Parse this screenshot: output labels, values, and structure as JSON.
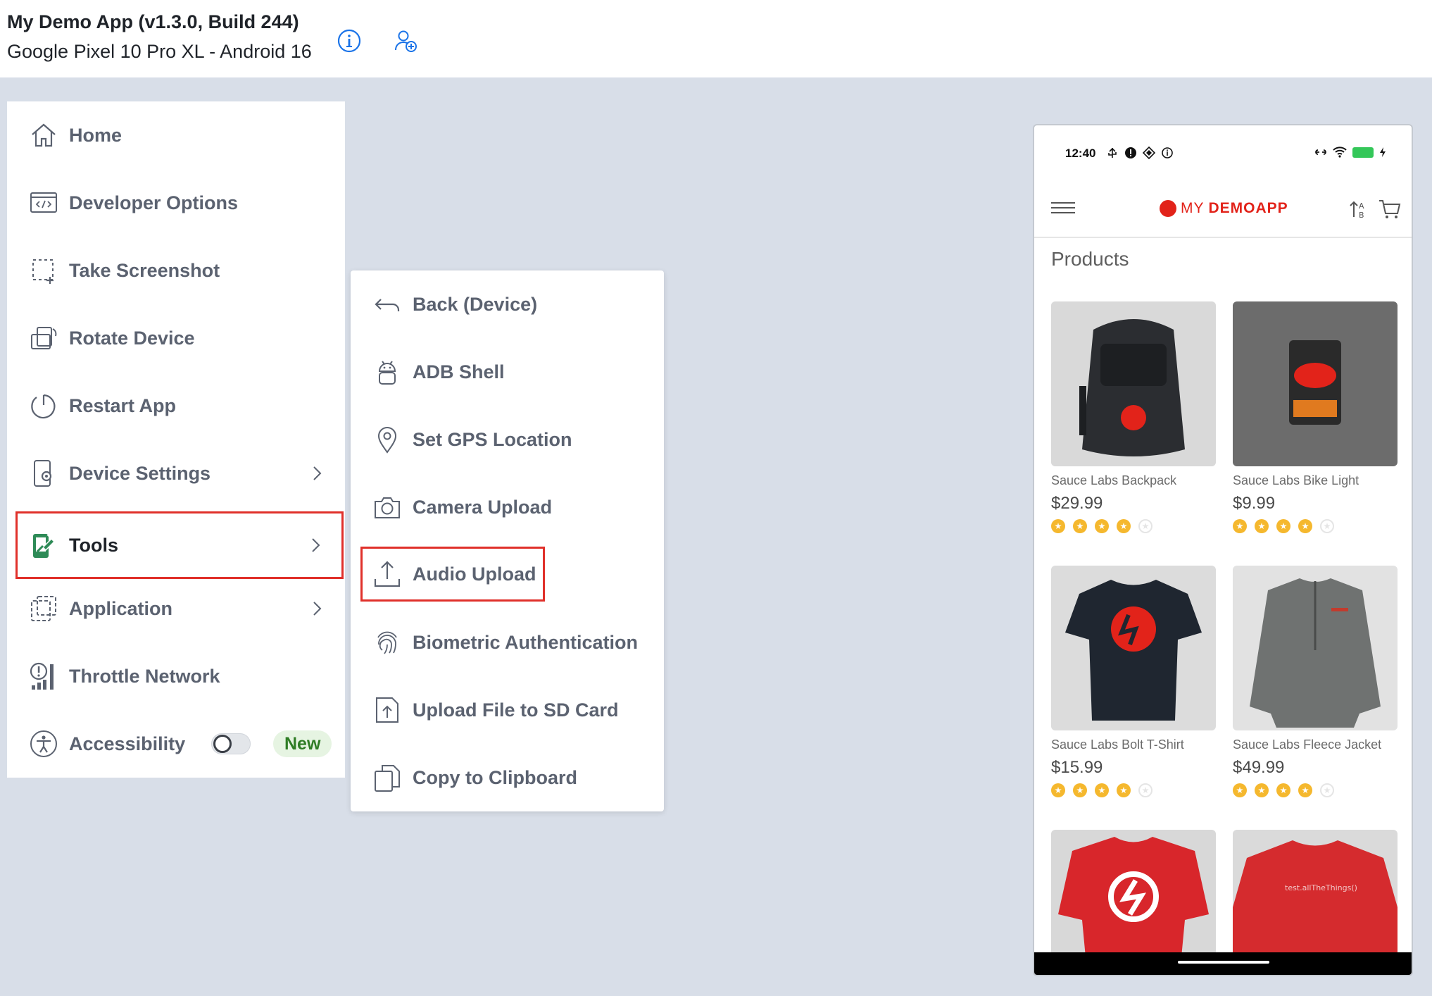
{
  "header": {
    "app_title": "My Demo App (v1.3.0, Build 244)",
    "device": "Google Pixel 10 Pro XL - Android 16",
    "icons": [
      "info-icon",
      "add-user-icon"
    ],
    "accent_color": "#1a73e8"
  },
  "left_menu": {
    "items": [
      {
        "label": "Home",
        "icon": "home-icon"
      },
      {
        "label": "Developer Options",
        "icon": "code-window-icon"
      },
      {
        "label": "Take Screenshot",
        "icon": "screenshot-icon"
      },
      {
        "label": "Rotate Device",
        "icon": "rotate-device-icon"
      },
      {
        "label": "Restart App",
        "icon": "restart-icon"
      },
      {
        "label": "Device Settings",
        "icon": "device-settings-icon",
        "has_submenu": true
      },
      {
        "label": "Tools",
        "icon": "tools-icon",
        "has_submenu": true,
        "selected": true
      },
      {
        "label": "Application",
        "icon": "application-icon",
        "has_submenu": true
      },
      {
        "label": "Throttle Network",
        "icon": "throttle-network-icon"
      },
      {
        "label": "Accessibility",
        "icon": "accessibility-icon",
        "toggle": false,
        "badge": "New"
      }
    ],
    "highlight_color": "#e0302a",
    "tools_icon_color": "#2e8b57"
  },
  "submenu": {
    "items": [
      {
        "label": "Back (Device)",
        "icon": "back-arrow-icon"
      },
      {
        "label": "ADB Shell",
        "icon": "android-icon"
      },
      {
        "label": "Set GPS Location",
        "icon": "location-pin-icon"
      },
      {
        "label": "Camera Upload",
        "icon": "camera-icon"
      },
      {
        "label": "Audio Upload",
        "icon": "upload-icon",
        "highlighted": true
      },
      {
        "label": "Biometric Authentication",
        "icon": "fingerprint-icon"
      },
      {
        "label": "Upload File to SD Card",
        "icon": "file-upload-icon"
      },
      {
        "label": "Copy to Clipboard",
        "icon": "clipboard-icon"
      }
    ]
  },
  "phone": {
    "status": {
      "time": "12:40"
    },
    "brand_left": "MY",
    "brand_right": "DEMOAPP",
    "brand_color": "#e2231a",
    "products_title": "Products",
    "products": [
      {
        "name": "Sauce Labs Backpack",
        "price": "$29.99",
        "rating": 4,
        "image": "black-backpack"
      },
      {
        "name": "Sauce Labs Bike Light",
        "price": "$9.99",
        "rating": 4,
        "image": "red-bike-light"
      },
      {
        "name": "Sauce Labs Bolt T-Shirt",
        "price": "$15.99",
        "rating": 4,
        "image": "black-tshirt"
      },
      {
        "name": "Sauce Labs Fleece Jacket",
        "price": "$49.99",
        "rating": 4,
        "image": "grey-fleece-jacket"
      },
      {
        "name": "",
        "price": "",
        "rating": 0,
        "image": "red-onesie"
      },
      {
        "name": "",
        "price": "",
        "rating": 0,
        "image": "red-tshirt",
        "image_text": "test.allTheThings()"
      }
    ],
    "star_color": "#f5b82e"
  }
}
